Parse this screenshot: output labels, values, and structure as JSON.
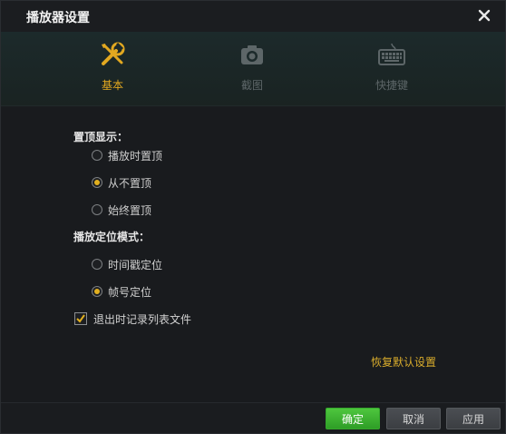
{
  "window": {
    "title": "播放器设置",
    "close_icon": "close-icon"
  },
  "tabs": [
    {
      "label": "基本",
      "icon": "tools-icon",
      "active": true
    },
    {
      "label": "截图",
      "icon": "camera-icon",
      "active": false
    },
    {
      "label": "快捷键",
      "icon": "keyboard-icon",
      "active": false
    }
  ],
  "pin_group": {
    "label": "置顶显示：",
    "options": [
      {
        "label": "播放时置顶",
        "selected": false
      },
      {
        "label": "从不置顶",
        "selected": true
      },
      {
        "label": "始终置顶",
        "selected": false
      }
    ]
  },
  "seek_group": {
    "label": "播放定位模式：",
    "options": [
      {
        "label": "时间戳定位",
        "selected": false
      },
      {
        "label": "帧号定位",
        "selected": true
      }
    ]
  },
  "record_list_checkbox": {
    "label": "退出时记录列表文件",
    "checked": true
  },
  "restore_defaults_label": "恢复默认设置",
  "buttons": {
    "ok": "确定",
    "cancel": "取消",
    "apply": "应用"
  },
  "colors": {
    "accent": "#e2a820",
    "ok_button": "#3cb531",
    "background": "#1b1d20"
  }
}
